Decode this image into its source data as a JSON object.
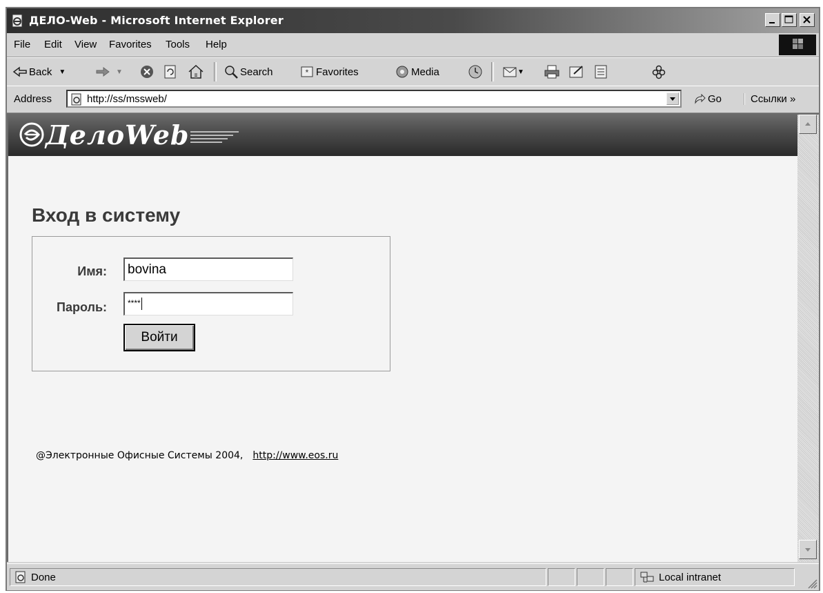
{
  "window": {
    "title": "ДЕЛО-Web - Microsoft Internet Explorer"
  },
  "menu": {
    "items": [
      "File",
      "Edit",
      "View",
      "Favorites",
      "Tools",
      "Help"
    ]
  },
  "toolbar": {
    "back_label": "Back",
    "search_label": "Search",
    "favorites_label": "Favorites",
    "media_label": "Media"
  },
  "address": {
    "label": "Address",
    "url": "http://ss/mssweb/",
    "go_label": "Go",
    "links_label": "Ссылки"
  },
  "page": {
    "logo_text": "ДелоWeb",
    "heading": "Вход в систему",
    "login": {
      "name_label": "Имя:",
      "name_value": "bovina",
      "password_label": "Пароль:",
      "password_value": "****",
      "submit_label": "Войти"
    },
    "footer": {
      "copyright": "@Электронные Офисные Системы 2004,",
      "link": "http://www.eos.ru"
    }
  },
  "status": {
    "text": "Done",
    "zone": "Local intranet"
  }
}
